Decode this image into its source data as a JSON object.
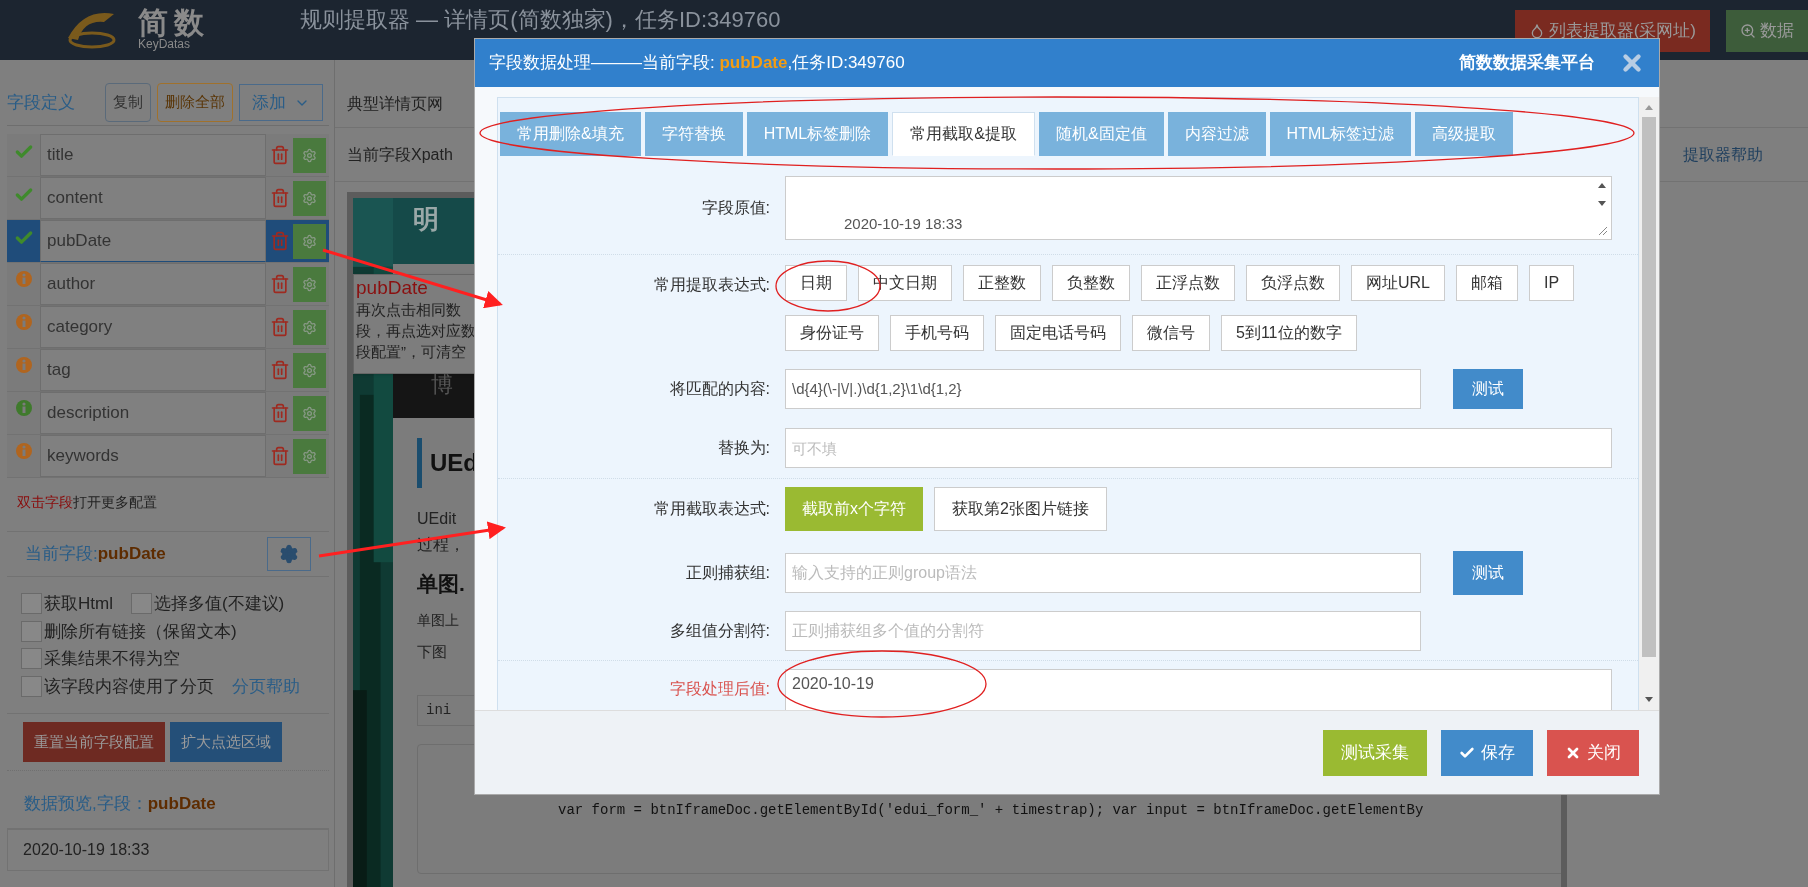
{
  "header": {
    "logo_text": "简数",
    "logo_subtext": "KeyDatas",
    "title": "规则提取器 — 详情页(简数独家)，任务ID:349760",
    "buttons": [
      {
        "label": "列表提取器(采网址)",
        "kind": "danger"
      },
      {
        "label": "数据",
        "kind": "success"
      }
    ]
  },
  "left_panel": {
    "title": "字段定义",
    "buttons": [
      {
        "label": "复制",
        "kind": "default"
      },
      {
        "label": "删除全部",
        "kind": "warning"
      }
    ],
    "add_dropdown": "添加",
    "fields": [
      {
        "name": "title",
        "kind": "ok",
        "selected": false
      },
      {
        "name": "content",
        "kind": "ok",
        "selected": false
      },
      {
        "name": "pubDate",
        "kind": "ok",
        "selected": true
      },
      {
        "name": "author",
        "kind": "warning",
        "selected": false
      },
      {
        "name": "category",
        "kind": "warning",
        "selected": false
      },
      {
        "name": "tag",
        "kind": "warning",
        "selected": false
      },
      {
        "name": "description",
        "kind": "info",
        "selected": false
      },
      {
        "name": "keywords",
        "kind": "warning",
        "selected": false
      }
    ],
    "hint": {
      "emphasis": "双击字段",
      "text": "打开更多配置"
    },
    "current_field": {
      "label": "当前字段:",
      "field": "pubDate"
    },
    "options": [
      [
        {
          "label": "获取Html",
          "checked": false
        },
        {
          "label": "选择多值(不建议)",
          "checked": false
        }
      ],
      [
        {
          "label": "删除所有链接（保留文本)",
          "checked": false
        }
      ],
      [
        {
          "label": "采集结果不得为空",
          "checked": false
        }
      ],
      [
        {
          "label": "该字段内容使用了分页",
          "checked": false
        }
      ]
    ],
    "pagination_help": "分页帮助",
    "actions": [
      {
        "label": "重置当前字段配置",
        "kind": "danger"
      },
      {
        "label": "扩大点选区域",
        "kind": "primary"
      }
    ],
    "preview": {
      "label": "数据预览,字段：",
      "field": "pubDate",
      "value": "2020-10-19 18:33"
    }
  },
  "center": {
    "url_label": "典型详情页网",
    "xpath_label": "当前字段Xpath",
    "help_link": "提取器帮助",
    "page": {
      "banner_text": "明",
      "tooltip": {
        "title": "pubDate",
        "lines": [
          "再次点击相同数",
          "段，再点选对应数",
          "段配置”，可清空"
        ]
      },
      "band_text": "博",
      "heading": "UEd",
      "paragraph_lines": [
        "UEdit",
        "过程，"
      ],
      "subheading": "单图.",
      "line_1": "单图上",
      "line_2": "下图",
      "code_tag": "ini",
      "code_line": "var form = btnIframeDoc.getElementById('edui_form_' + timestrap); var input = btnIframeDoc.getElementBy"
    }
  },
  "modal": {
    "title": {
      "prefix": "字段数据处理———当前字段: ",
      "field": "pubDate",
      "suffix": ",任务ID:349760"
    },
    "brand": "简数数据采集平台",
    "tabs": [
      {
        "label": "常用删除&填充",
        "selected": false
      },
      {
        "label": "字符替换",
        "selected": false
      },
      {
        "label": "HTML标签删除",
        "selected": false
      },
      {
        "label": "常用截取&提取",
        "selected": true
      },
      {
        "label": "随机&固定值",
        "selected": false
      },
      {
        "label": "内容过滤",
        "selected": false
      },
      {
        "label": "HTML标签过滤",
        "selected": false
      },
      {
        "label": "高级提取",
        "selected": false
      }
    ],
    "original_value": {
      "label": "字段原值:",
      "value": "2020-10-19 18:33"
    },
    "extract_expressions": {
      "label": "常用提取表达式:",
      "chips": [
        [
          "日期",
          "中文日期",
          "正整数",
          "负整数",
          "正浮点数",
          "负浮点数",
          "网址URL",
          "邮箱",
          "IP"
        ],
        [
          "身份证号",
          "手机号码",
          "固定电话号码",
          "微信号",
          "5到11位的数字"
        ]
      ]
    },
    "match": {
      "label": "将匹配的内容:",
      "value": "\\d{4}(\\-|\\/|.)\\d{1,2}\\1\\d{1,2}",
      "button": "测试"
    },
    "replace": {
      "label": "替换为:",
      "placeholder": "可不填"
    },
    "cut_expressions": {
      "label": "常用截取表达式:",
      "buttons": [
        {
          "label": "截取前x个字符",
          "selected": true
        },
        {
          "label": "获取第2张图片链接",
          "selected": false
        }
      ]
    },
    "group": {
      "label": "正则捕获组:",
      "placeholder": "输入支持的正则group语法",
      "button": "测试"
    },
    "separator": {
      "label": "多组值分割符:",
      "placeholder": "正则捕获组多个值的分割符"
    },
    "result": {
      "label": "字段处理后值:",
      "value": "2020-10-19"
    },
    "footer_buttons": [
      {
        "label": "测试采集",
        "kind": "success"
      },
      {
        "label": "保存",
        "kind": "primary"
      },
      {
        "label": "关闭",
        "kind": "danger"
      }
    ]
  }
}
